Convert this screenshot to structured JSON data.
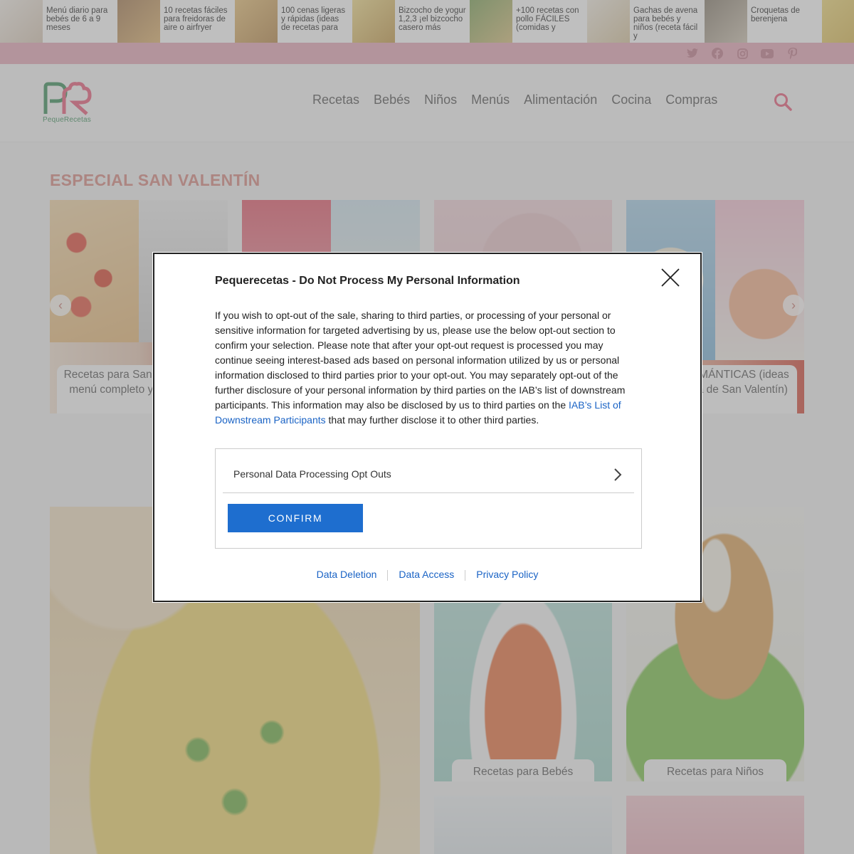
{
  "top_strip": [
    {
      "title": "Menú diario para bebés de 6 a 9 meses",
      "color": "#e9e2d9"
    },
    {
      "title": "10 recetas fáciles para freidoras de aire o airfryer",
      "color": "#d9a866"
    },
    {
      "title": "100 cenas ligeras y rápidas (ideas de recetas para",
      "color": "#e2b86b"
    },
    {
      "title": "Bizcocho de yogur 1,2,3 ¡el bizcocho casero más",
      "color": "#e8cc7a"
    },
    {
      "title": "+100 recetas con pollo FÁCILES (comidas y",
      "color": "#c9b37a"
    },
    {
      "title": "Gachas de avena para bebés y niños (receta fácil y",
      "color": "#efe6d9"
    },
    {
      "title": "Croquetas de berenjena",
      "color": "#9a8f80"
    },
    {
      "title": "",
      "color": "#e8d27a"
    }
  ],
  "social": {
    "icons": [
      "twitter-icon",
      "facebook-icon",
      "instagram-icon",
      "youtube-icon",
      "pinterest-icon"
    ]
  },
  "header": {
    "logo_text": "PequeRecetas",
    "nav": [
      "Recetas",
      "Bebés",
      "Niños",
      "Menús",
      "Alimentación",
      "Cocina",
      "Compras"
    ]
  },
  "section": {
    "title": "ESPECIAL SAN VALENTÍN"
  },
  "cards": [
    {
      "caption": "Recetas para San Valentín (un menú completo y romántico)"
    },
    {
      "caption": ""
    },
    {
      "caption": ""
    },
    {
      "caption": "CENAS ROMÁNTICAS (ideas para la cena de San Valentín)"
    }
  ],
  "tiles": {
    "babies": "Recetas para Bebés",
    "kids": "Recetas para Niños"
  },
  "modal": {
    "title": "Pequerecetas - Do Not Process My Personal Information",
    "body": "If you wish to opt-out of the sale, sharing to third parties, or processing of your personal or sensitive information for targeted advertising by us, please use the below opt-out section to confirm your selection. Please note that after your opt-out request is processed you may continue seeing interest-based ads based on personal information utilized by us or personal information disclosed to third parties prior to your opt-out. You may separately opt-out of the further disclosure of your personal information by third parties on the IAB’s list of downstream participants. This information may also be disclosed by us to third parties on the ",
    "link": "IAB’s List of Downstream Participants",
    "body_end": " that may further disclose it to other third parties.",
    "opt_label": "Personal Data Processing Opt Outs",
    "confirm": "CONFIRM",
    "links": [
      "Data Deletion",
      "Data Access",
      "Privacy Policy"
    ]
  },
  "colors": {
    "accent": "#1e6ecf",
    "pink_bar": "#e7a9b8",
    "section_title": "#d98a83",
    "logo_green": "#3a8e5b",
    "logo_pink": "#e85d7a"
  }
}
